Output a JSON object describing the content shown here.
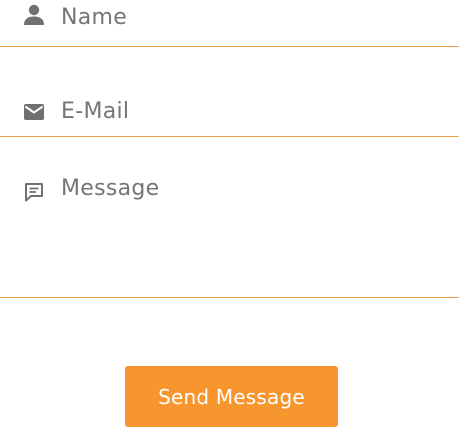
{
  "form": {
    "name_field": {
      "placeholder": "Name",
      "icon": "user-icon"
    },
    "email_field": {
      "placeholder": "E-Mail",
      "icon": "mail-icon"
    },
    "message_field": {
      "placeholder": "Message",
      "icon": "chat-icon"
    },
    "submit_label": "Send Message"
  },
  "colors": {
    "accent": "#f7962f",
    "underline": "#e8a04a",
    "icon": "#707070",
    "placeholder": "#757575"
  }
}
